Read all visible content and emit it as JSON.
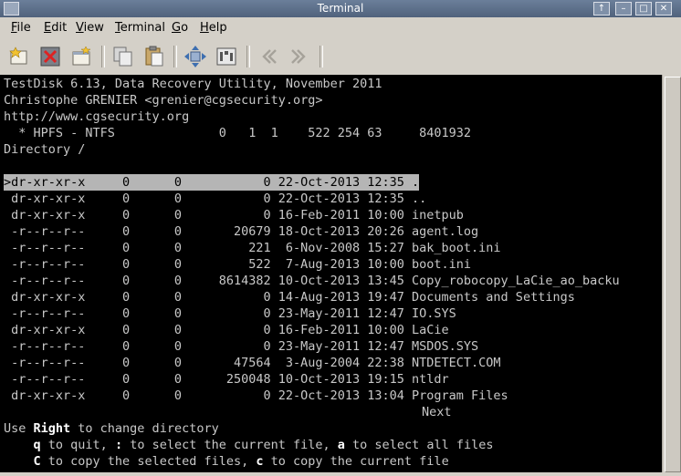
{
  "window": {
    "title": "Terminal",
    "controls": [
      "↑",
      "–",
      "□",
      "✕"
    ]
  },
  "menu": [
    {
      "label": "File",
      "mnemonic": "F"
    },
    {
      "label": "Edit",
      "mnemonic": "E"
    },
    {
      "label": "View",
      "mnemonic": "V"
    },
    {
      "label": "Terminal",
      "mnemonic": "T"
    },
    {
      "label": "Go",
      "mnemonic": "G"
    },
    {
      "label": "Help",
      "mnemonic": "H"
    }
  ],
  "toolbar": {
    "icons": [
      "new-tab-icon",
      "close-tab-icon",
      "new-window-icon",
      "copy-icon",
      "paste-icon",
      "fullscreen-icon",
      "preferences-icon",
      "back-arrow-icon",
      "forward-arrow-icon"
    ]
  },
  "terminal": {
    "header": [
      "TestDisk 6.13, Data Recovery Utility, November 2011",
      "Christophe GRENIER <grenier@cgsecurity.org>",
      "http://www.cgsecurity.org",
      "  * HPFS - NTFS              0   1  1    522 254 63     8401932",
      "Directory /"
    ],
    "entries": [
      {
        "perms": "dr-xr-xr-x",
        "uid": "0",
        "gid": "0",
        "size": "0",
        "date": "22-Oct-2013",
        "time": "12:35",
        "name": ".",
        "selected": true
      },
      {
        "perms": "dr-xr-xr-x",
        "uid": "0",
        "gid": "0",
        "size": "0",
        "date": "22-Oct-2013",
        "time": "12:35",
        "name": ".."
      },
      {
        "perms": "dr-xr-xr-x",
        "uid": "0",
        "gid": "0",
        "size": "0",
        "date": "16-Feb-2011",
        "time": "10:00",
        "name": "inetpub"
      },
      {
        "perms": "-r--r--r--",
        "uid": "0",
        "gid": "0",
        "size": "20679",
        "date": "18-Oct-2013",
        "time": "20:26",
        "name": "agent.log"
      },
      {
        "perms": "-r--r--r--",
        "uid": "0",
        "gid": "0",
        "size": "221",
        "date": "6-Nov-2008",
        "time": "15:27",
        "name": "bak_boot.ini"
      },
      {
        "perms": "-r--r--r--",
        "uid": "0",
        "gid": "0",
        "size": "522",
        "date": "7-Aug-2013",
        "time": "10:00",
        "name": "boot.ini"
      },
      {
        "perms": "-r--r--r--",
        "uid": "0",
        "gid": "0",
        "size": "8614382",
        "date": "10-Oct-2013",
        "time": "13:45",
        "name": "Copy_robocopy_LaCie_ao_backu"
      },
      {
        "perms": "dr-xr-xr-x",
        "uid": "0",
        "gid": "0",
        "size": "0",
        "date": "14-Aug-2013",
        "time": "19:47",
        "name": "Documents and Settings"
      },
      {
        "perms": "-r--r--r--",
        "uid": "0",
        "gid": "0",
        "size": "0",
        "date": "23-May-2011",
        "time": "12:47",
        "name": "IO.SYS"
      },
      {
        "perms": "dr-xr-xr-x",
        "uid": "0",
        "gid": "0",
        "size": "0",
        "date": "16-Feb-2011",
        "time": "10:00",
        "name": "LaCie"
      },
      {
        "perms": "-r--r--r--",
        "uid": "0",
        "gid": "0",
        "size": "0",
        "date": "23-May-2011",
        "time": "12:47",
        "name": "MSDOS.SYS"
      },
      {
        "perms": "-r--r--r--",
        "uid": "0",
        "gid": "0",
        "size": "47564",
        "date": "3-Aug-2004",
        "time": "22:38",
        "name": "NTDETECT.COM"
      },
      {
        "perms": "-r--r--r--",
        "uid": "0",
        "gid": "0",
        "size": "250048",
        "date": "10-Oct-2013",
        "time": "19:15",
        "name": "ntldr"
      },
      {
        "perms": "dr-xr-xr-x",
        "uid": "0",
        "gid": "0",
        "size": "0",
        "date": "22-Oct-2013",
        "time": "13:04",
        "name": "Program Files"
      }
    ],
    "next_label": "Next",
    "help": [
      {
        "parts": [
          {
            "t": "Use ",
            "b": false
          },
          {
            "t": "Right",
            "b": true
          },
          {
            "t": " to change directory",
            "b": false
          }
        ]
      },
      {
        "parts": [
          {
            "t": "    ",
            "b": false
          },
          {
            "t": "q",
            "b": true
          },
          {
            "t": " to quit, ",
            "b": false
          },
          {
            "t": ":",
            "b": true
          },
          {
            "t": " to select the current file, ",
            "b": false
          },
          {
            "t": "a",
            "b": true
          },
          {
            "t": " to select all files",
            "b": false
          }
        ]
      },
      {
        "parts": [
          {
            "t": "    ",
            "b": false
          },
          {
            "t": "C",
            "b": true
          },
          {
            "t": " to copy the selected files, ",
            "b": false
          },
          {
            "t": "c",
            "b": true
          },
          {
            "t": " to copy the current file",
            "b": false
          }
        ]
      }
    ]
  }
}
